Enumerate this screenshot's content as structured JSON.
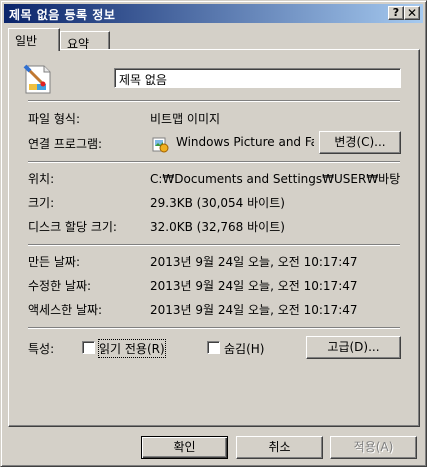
{
  "window": {
    "title": "제목 없음 등록 정보",
    "help_label": "?",
    "close_label": "✕"
  },
  "tabs": [
    {
      "label": "일반",
      "active": true
    },
    {
      "label": "요약",
      "active": false
    }
  ],
  "file": {
    "name": "제목 없음",
    "icon": "bitmap-paint-icon"
  },
  "properties": {
    "type_label": "파일 형식:",
    "type_value": "비트맵 이미지",
    "opens_with_label": "연결 프로그램:",
    "opens_with_value": "Windows Picture and Fa",
    "opens_with_icon": "picture-viewer-icon",
    "change_button": "변경(C)...",
    "location_label": "위치:",
    "location_value": "C:₩Documents and Settings₩USER₩바탕 화",
    "size_label": "크기:",
    "size_value": "29.3KB (30,054 바이트)",
    "size_on_disk_label": "디스크 할당 크기:",
    "size_on_disk_value": "32.0KB (32,768 바이트)",
    "created_label": "만든 날짜:",
    "created_value": "2013년 9월 24일 오늘, 오전 10:17:47",
    "modified_label": "수정한 날짜:",
    "modified_value": "2013년 9월 24일 오늘, 오전 10:17:47",
    "accessed_label": "액세스한 날짜:",
    "accessed_value": "2013년 9월 24일 오늘, 오전 10:17:47"
  },
  "attributes": {
    "label": "특성:",
    "readonly_label": "읽기 전용(R)",
    "readonly_checked": false,
    "hidden_label": "숨김(H)",
    "hidden_checked": false,
    "advanced_button": "고급(D)..."
  },
  "footer": {
    "ok": "확인",
    "cancel": "취소",
    "apply": "적용(A)"
  },
  "colors": {
    "face": "#d4d0c8",
    "title_start": "#0a246a",
    "title_end": "#a6caf0"
  }
}
